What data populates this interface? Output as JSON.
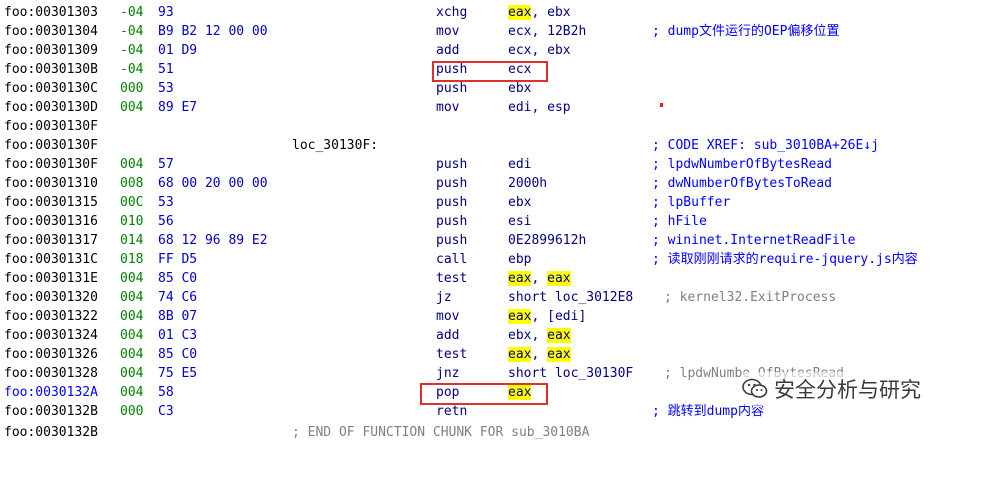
{
  "listing": [
    {
      "addr": "foo:00301303",
      "sp": "-04",
      "bytes": "93",
      "mnemonic": "xchg",
      "op1": "eax",
      "op1_hl": true,
      "op2": ", ebx"
    },
    {
      "addr": "foo:00301304",
      "sp": "-04",
      "bytes": "B9 B2 12 00 00",
      "mnemonic": "mov",
      "op1": "ecx, 12B2h",
      "comment": "; dump文件运行的OEP偏移位置"
    },
    {
      "addr": "foo:00301309",
      "sp": "-04",
      "bytes": "01 D9",
      "mnemonic": "add",
      "op1": "ecx, ebx"
    },
    {
      "addr": "foo:0030130B",
      "sp": "-04",
      "bytes": "51",
      "mnemonic": "push",
      "op1": "ecx"
    },
    {
      "addr": "foo:0030130C",
      "sp": "000",
      "bytes": "53",
      "mnemonic": "push",
      "op1": "ebx"
    },
    {
      "addr": "foo:0030130D",
      "sp": "004",
      "bytes": "89 E7",
      "mnemonic": "mov",
      "op1": "edi, esp"
    },
    {
      "addr": "foo:0030130F"
    },
    {
      "addr": "foo:0030130F",
      "label": "loc_30130F:",
      "comment": "; CODE XREF: sub_3010BA+26E↓j"
    },
    {
      "addr": "foo:0030130F",
      "sp": "004",
      "bytes": "57",
      "mnemonic": "push",
      "op1": "edi",
      "comment": "; lpdwNumberOfBytesRead"
    },
    {
      "addr": "foo:00301310",
      "sp": "008",
      "bytes": "68 00 20 00 00",
      "mnemonic": "push",
      "op1": "2000h",
      "comment": "; dwNumberOfBytesToRead"
    },
    {
      "addr": "foo:00301315",
      "sp": "00C",
      "bytes": "53",
      "mnemonic": "push",
      "op1": "ebx",
      "comment": "; lpBuffer"
    },
    {
      "addr": "foo:00301316",
      "sp": "010",
      "bytes": "56",
      "mnemonic": "push",
      "op1": "esi",
      "comment": "; hFile"
    },
    {
      "addr": "foo:00301317",
      "sp": "014",
      "bytes": "68 12 96 89 E2",
      "mnemonic": "push",
      "op1": "0E2899612h",
      "comment": "; wininet.InternetReadFile"
    },
    {
      "addr": "foo:0030131C",
      "sp": "018",
      "bytes": "FF D5",
      "mnemonic": "call",
      "op1": "ebp",
      "comment": "; 读取刚刚请求的require-jquery.js内容"
    },
    {
      "addr": "foo:0030131E",
      "sp": "004",
      "bytes": "85 C0",
      "mnemonic": "test",
      "op1": "eax",
      "op1_hl": true,
      "op2": ", ",
      "op3": "eax",
      "op3_hl": true
    },
    {
      "addr": "foo:00301320",
      "sp": "004",
      "bytes": "74 C6",
      "mnemonic": "jz",
      "op1": "short loc_3012E8",
      "inline": "; kernel32.ExitProcess"
    },
    {
      "addr": "foo:00301322",
      "sp": "004",
      "bytes": "8B 07",
      "mnemonic": "mov",
      "op1": "eax",
      "op1_hl": true,
      "op2": ", [edi]"
    },
    {
      "addr": "foo:00301324",
      "sp": "004",
      "bytes": "01 C3",
      "mnemonic": "add",
      "op1": "ebx, ",
      "op3": "eax",
      "op3_hl": true
    },
    {
      "addr": "foo:00301326",
      "sp": "004",
      "bytes": "85 C0",
      "mnemonic": "test",
      "op1": "eax",
      "op1_hl": true,
      "op2": ", ",
      "op3": "eax",
      "op3_hl": true
    },
    {
      "addr": "foo:00301328",
      "sp": "004",
      "bytes": "75 E5",
      "mnemonic": "jnz",
      "op1": "short loc_30130F",
      "inline": "; lpdwNumbe OfBytesRead"
    },
    {
      "addr": "foo:0030132A",
      "sp": "004",
      "bytes": "58",
      "mnemonic": "pop",
      "op1": "eax",
      "op1_hl": true,
      "current": true
    },
    {
      "addr": "foo:0030132B",
      "sp": "000",
      "bytes": "C3",
      "mnemonic": "retn",
      "comment": "; 跳转到dump内容"
    }
  ],
  "partial_last_line": "; END OF FUNCTION CHUNK FOR sub_3010BA",
  "partial_last_addr": "foo:0030132B",
  "watermark": {
    "text": "安全分析与研究",
    "icon": "wechat-logo-icon"
  },
  "colors": {
    "highlight": "#ffff00",
    "box": "#e0302a",
    "address_current": "#0000ff",
    "mnemonic": "#000080"
  }
}
